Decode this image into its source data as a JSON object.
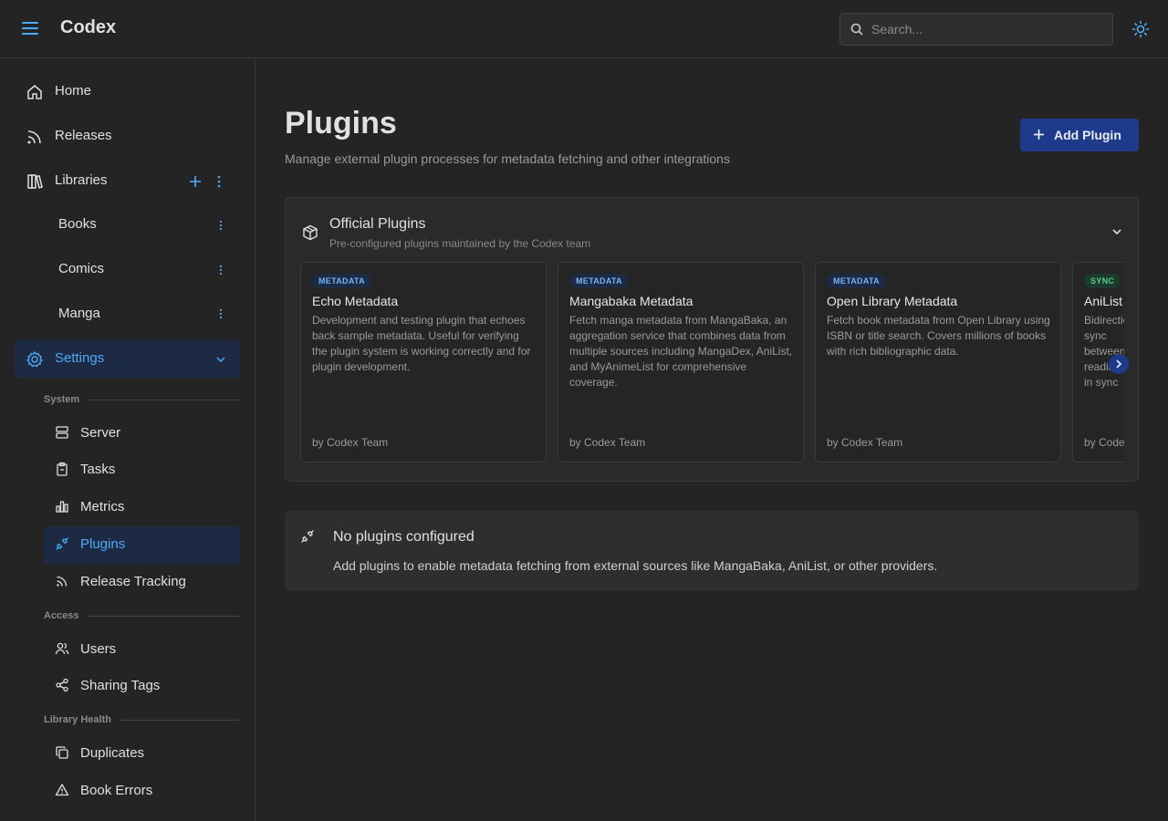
{
  "header": {
    "app_title": "Codex",
    "search_placeholder": "Search..."
  },
  "sidebar": {
    "home": "Home",
    "releases": "Releases",
    "libraries": "Libraries",
    "library_items": [
      "Books",
      "Comics",
      "Manga"
    ],
    "settings": "Settings",
    "sections": {
      "system": "System",
      "access": "Access",
      "library_health": "Library Health"
    },
    "system_items": [
      "Server",
      "Tasks",
      "Metrics",
      "Plugins",
      "Release Tracking"
    ],
    "access_items": [
      "Users",
      "Sharing Tags"
    ],
    "health_items": [
      "Duplicates",
      "Book Errors"
    ]
  },
  "main": {
    "title": "Plugins",
    "subtitle": "Manage external plugin processes for metadata fetching and other integrations",
    "add_button": "Add Plugin",
    "official": {
      "title": "Official Plugins",
      "subtitle": "Pre-configured plugins maintained by the Codex team",
      "cards": [
        {
          "badge": "METADATA",
          "title": "Echo Metadata",
          "desc": "Development and testing plugin that echoes back sample metadata. Useful for verifying the plugin system is working correctly and for plugin development.",
          "author": "by Codex Team"
        },
        {
          "badge": "METADATA",
          "title": "Mangabaka Metadata",
          "desc": "Fetch manga metadata from MangaBaka, an aggregation service that combines data from multiple sources including MangaDex, AniList, and MyAnimeList for comprehensive coverage.",
          "author": "by Codex Team"
        },
        {
          "badge": "METADATA",
          "title": "Open Library Metadata",
          "desc": "Fetch book metadata from Open Library using ISBN or title search. Covers millions of books with rich bibliographic data.",
          "author": "by Codex Team"
        },
        {
          "badge": "SYNC",
          "title": "AniList",
          "desc": "Bidirectional sync between reading in sync",
          "author": "by Codex Team"
        }
      ]
    },
    "empty": {
      "title": "No plugins configured",
      "desc": "Add plugins to enable metadata fetching from external sources like MangaBaka, AniList, or other providers."
    }
  },
  "colors": {
    "accent": "#4dabf7",
    "primary_button": "#1e3a8a",
    "active_bg": "#1c2a44"
  }
}
